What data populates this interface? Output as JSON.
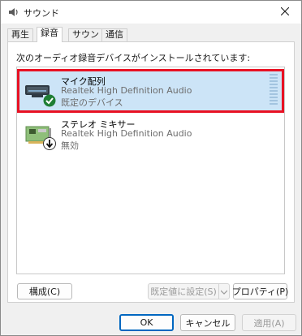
{
  "window": {
    "title": "サウンド"
  },
  "tabs": [
    {
      "label": "再生"
    },
    {
      "label": "録音"
    },
    {
      "label": "サウンド"
    },
    {
      "label": "通信"
    }
  ],
  "panel": {
    "instruction": "次のオーディオ録音デバイスがインストールされています:",
    "devices": [
      {
        "name": "マイク配列",
        "driver": "Realtek High Definition Audio",
        "status": "既定のデバイス",
        "selected": true
      },
      {
        "name": "ステレオ ミキサー",
        "driver": "Realtek High Definition Audio",
        "status": "無効",
        "selected": false
      }
    ],
    "configure_label": "構成(C)",
    "set_default_label": "既定値に設定(S)",
    "properties_label": "プロパティ(P)"
  },
  "footer": {
    "ok_label": "OK",
    "cancel_label": "キャンセル",
    "apply_label": "適用(A)"
  },
  "colors": {
    "accent": "#0067c0",
    "selection": "#cce4f7",
    "highlight_border": "#e81123",
    "default_check": "#1e7e34"
  }
}
